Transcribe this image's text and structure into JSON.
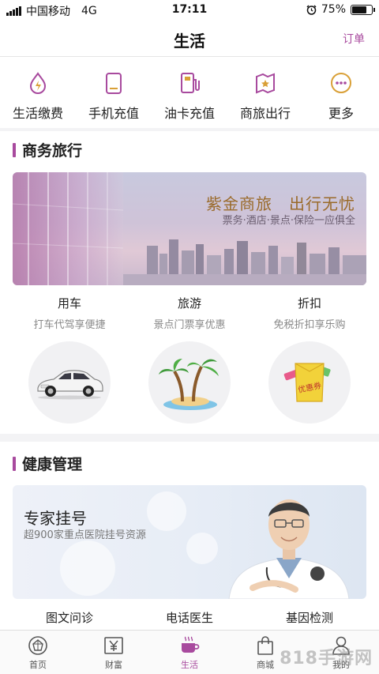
{
  "status_bar": {
    "carrier": "中国移动",
    "network": "4G",
    "time": "17:11",
    "battery": "75%",
    "battery_level": 0.75
  },
  "header": {
    "title": "生活",
    "orders_label": "订单"
  },
  "quick_actions": [
    {
      "label": "生活缴费",
      "icon": "utility-drop-icon"
    },
    {
      "label": "手机充值",
      "icon": "phone-icon"
    },
    {
      "label": "油卡充值",
      "icon": "fuel-pump-icon"
    },
    {
      "label": "商旅出行",
      "icon": "map-star-icon"
    },
    {
      "label": "更多",
      "icon": "more-dots-icon"
    }
  ],
  "business_travel": {
    "section_title": "商务旅行",
    "banner_title": "紫金商旅　出行无忧",
    "banner_subtitle": "票务·酒店·景点·保险一应俱全",
    "services": [
      {
        "title": "用车",
        "desc": "打车代驾享便捷",
        "icon": "car-icon"
      },
      {
        "title": "旅游",
        "desc": "景点门票享优惠",
        "icon": "palm-island-icon"
      },
      {
        "title": "折扣",
        "desc": "免税折扣享乐购",
        "icon": "coupon-icon",
        "coupon_text": "优惠券"
      }
    ]
  },
  "health": {
    "section_title": "健康管理",
    "banner_title": "专家挂号",
    "banner_subtitle": "超900家重点医院挂号资源",
    "items": [
      {
        "label": "图文问诊"
      },
      {
        "label": "电话医生"
      },
      {
        "label": "基因检测"
      }
    ]
  },
  "tabbar": [
    {
      "label": "首页",
      "icon": "home-icon"
    },
    {
      "label": "财富",
      "icon": "wealth-yen-icon"
    },
    {
      "label": "生活",
      "icon": "coffee-cup-icon",
      "active": true
    },
    {
      "label": "商城",
      "icon": "shopping-bag-icon"
    },
    {
      "label": "我的",
      "icon": "profile-icon"
    }
  ],
  "watermark": "818手游网",
  "colors": {
    "accent": "#a84a9e",
    "banner_gold": "#9a6a2a"
  }
}
